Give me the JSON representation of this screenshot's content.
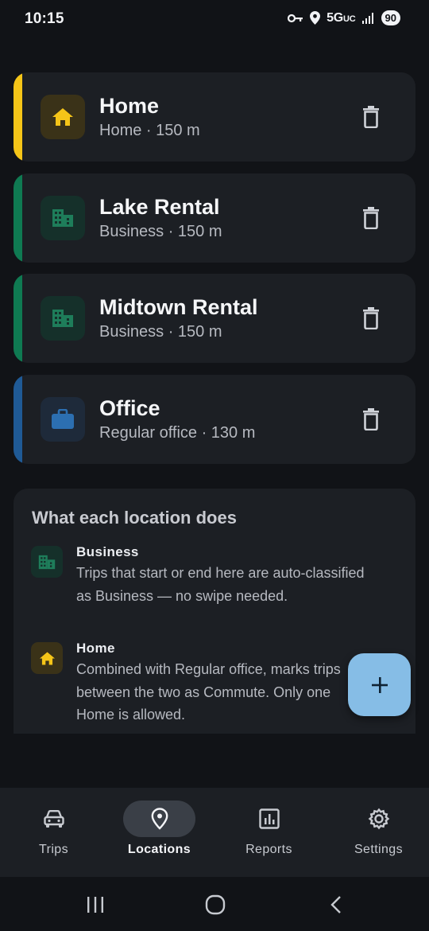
{
  "status_bar": {
    "time": "10:15",
    "network": "5G",
    "network_suffix": "UC",
    "battery": "90",
    "icons": [
      "vpn-key-icon",
      "location-pin-icon",
      "signal-icon"
    ]
  },
  "locations": [
    {
      "name": "Home",
      "detail": "Home · 150 m",
      "icon": "home-icon",
      "accent": "#f5c518",
      "icon_bg": "#3a3218",
      "icon_color": "#f5c518"
    },
    {
      "name": "Lake Rental",
      "detail": "Business · 150 m",
      "icon": "building-icon",
      "accent": "#0f7a52",
      "icon_bg": "#15302a",
      "icon_color": "#1e7d5a"
    },
    {
      "name": "Midtown Rental",
      "detail": "Business · 150 m",
      "icon": "building-icon",
      "accent": "#0f7a52",
      "icon_bg": "#15302a",
      "icon_color": "#1e7d5a"
    },
    {
      "name": "Office",
      "detail": "Regular office · 130 m",
      "icon": "briefcase-icon",
      "accent": "#1f5a96",
      "icon_bg": "#1e2a3a",
      "icon_color": "#2c6fb1"
    }
  ],
  "info": {
    "heading": "What each location does",
    "items": [
      {
        "title": "Business",
        "description": "Trips that start or end here are auto-classified as Business — no swipe needed.",
        "icon": "building-icon"
      },
      {
        "title": "Home",
        "description": "Combined with Regular office, marks trips between the two as Commute. Only one Home is allowed.",
        "icon": "home-icon"
      }
    ]
  },
  "fab": {
    "icon": "plus-icon"
  },
  "bottom_nav": {
    "items": [
      {
        "label": "Trips",
        "icon": "car-icon",
        "active": false
      },
      {
        "label": "Locations",
        "icon": "location-pin-icon",
        "active": true
      },
      {
        "label": "Reports",
        "icon": "chart-icon",
        "active": false
      },
      {
        "label": "Settings",
        "icon": "gear-icon",
        "active": false
      }
    ]
  },
  "system_nav": [
    "recents-icon",
    "home-circle-icon",
    "back-icon"
  ],
  "colors": {
    "background": "#111317",
    "surface": "#1c1f24",
    "fab": "#86bde6",
    "text_primary": "#f5f6f8",
    "text_secondary": "#b6b9c0"
  }
}
